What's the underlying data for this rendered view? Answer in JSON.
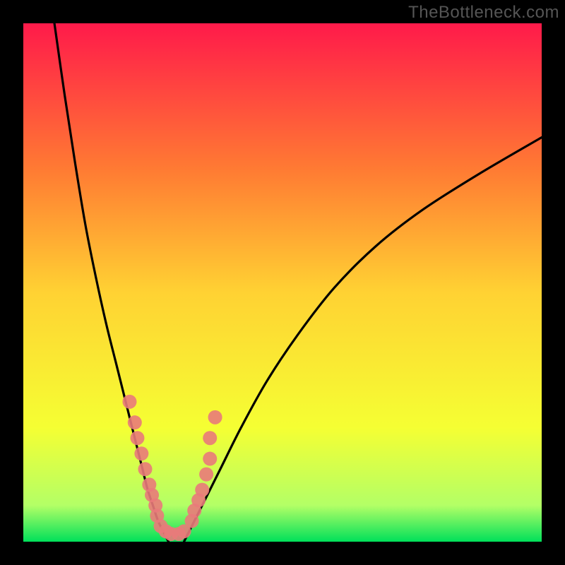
{
  "watermark": "TheBottleneck.com",
  "chart_data": {
    "type": "line",
    "title": "",
    "xlabel": "",
    "ylabel": "",
    "xlim": [
      0,
      100
    ],
    "ylim": [
      0,
      100
    ],
    "background_gradient": {
      "top": "#ff1a4a",
      "mid_upper": "#ff7a33",
      "mid": "#ffd233",
      "mid_lower": "#f5ff33",
      "lower": "#b3ff66",
      "bottom": "#00e05a"
    },
    "series": [
      {
        "name": "left-branch",
        "color": "#000000",
        "x": [
          6,
          8,
          10,
          12,
          14,
          16,
          18,
          20,
          22,
          23,
          24,
          25,
          26,
          27,
          28
        ],
        "y": [
          100,
          86,
          73,
          61,
          51,
          42,
          34,
          26,
          18,
          14,
          10,
          7,
          4,
          2,
          0
        ]
      },
      {
        "name": "right-branch",
        "color": "#000000",
        "x": [
          31,
          32,
          33,
          35,
          38,
          42,
          47,
          53,
          60,
          68,
          77,
          88,
          100
        ],
        "y": [
          0,
          2,
          4,
          8,
          14,
          22,
          31,
          40,
          49,
          57,
          64,
          71,
          78
        ]
      }
    ],
    "scatter": {
      "name": "points",
      "color": "#e97a7a",
      "radius": 10,
      "x": [
        20.5,
        21.5,
        22.0,
        22.8,
        23.5,
        24.3,
        24.8,
        25.5,
        25.8,
        26.5,
        27.5,
        28.5,
        30.0,
        31.0,
        32.5,
        33.0,
        33.8,
        34.5,
        35.3,
        36.0,
        36.0,
        37.0
      ],
      "y": [
        27,
        23,
        20,
        17,
        14,
        11,
        9,
        7,
        5,
        3,
        2,
        1.5,
        1.5,
        2,
        4,
        6,
        8,
        10,
        13,
        16,
        20,
        24
      ]
    }
  }
}
